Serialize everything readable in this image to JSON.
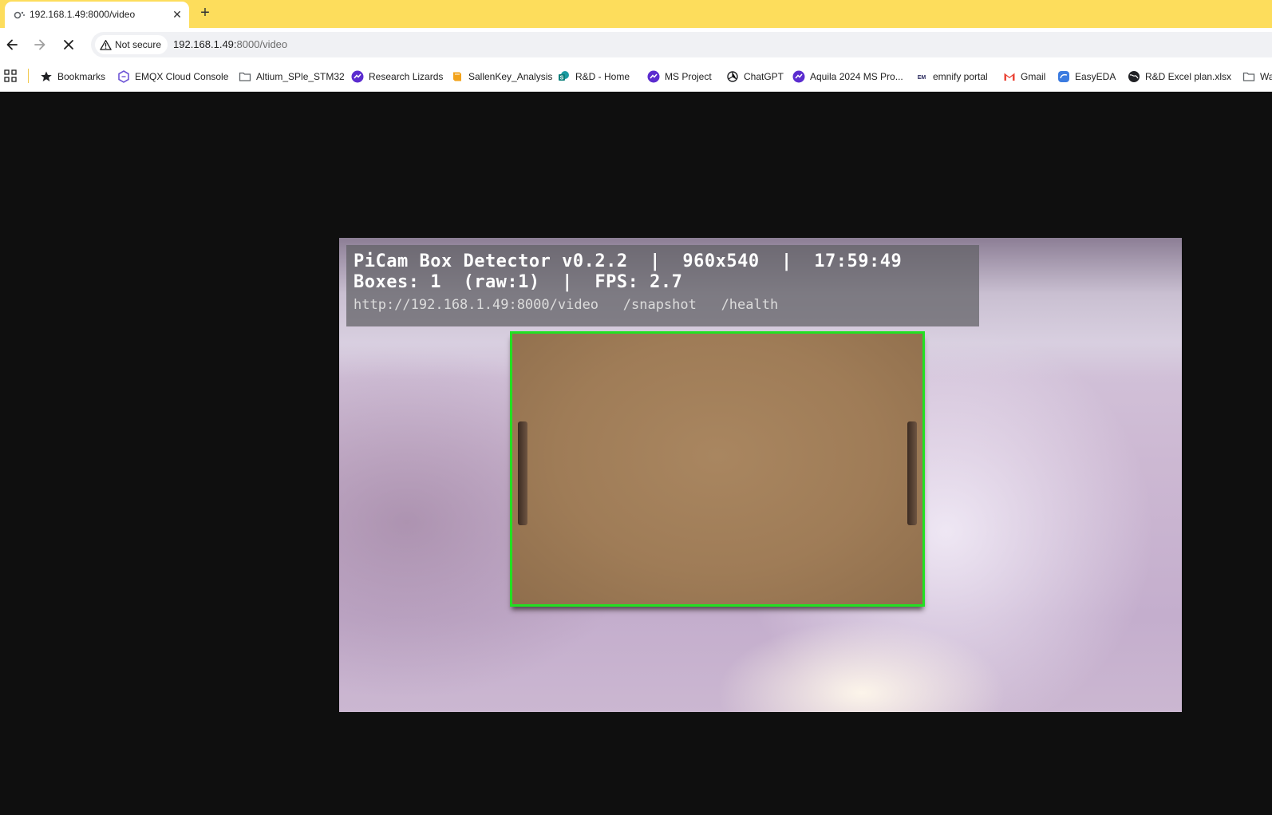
{
  "tab": {
    "title": "192.168.1.49:8000/video",
    "close_label": "✕",
    "new_tab_label": "+"
  },
  "toolbar": {
    "security_label": "Not secure",
    "url_host": "192.168.1.49:",
    "url_path": "8000/video"
  },
  "bookmarks": [
    {
      "label": "Bookmarks",
      "icon": "star-icon",
      "color": "#202124"
    },
    {
      "label": "EMQX Cloud Console",
      "icon": "emqx-icon",
      "color": "#6e55d6"
    },
    {
      "label": "Altium_SPle_STM32",
      "icon": "folder-icon",
      "color": "#5f6368"
    },
    {
      "label": "Research Lizards",
      "icon": "clickup-icon",
      "color": "#5b2ccf"
    },
    {
      "label": "SallenKey_Analysis",
      "icon": "book-icon",
      "color": "#f2a21a"
    },
    {
      "label": "R&D - Home",
      "icon": "sharepoint-icon",
      "color": "#0b7f7a"
    },
    {
      "label": "MS Project",
      "icon": "clickup-icon",
      "color": "#5b2ccf"
    },
    {
      "label": "ChatGPT",
      "icon": "openai-icon",
      "color": "#202124"
    },
    {
      "label": "Aquila 2024 MS Pro...",
      "icon": "clickup-icon",
      "color": "#5b2ccf"
    },
    {
      "label": "emnify portal",
      "icon": "emnify-icon",
      "color": "#2a2a5e"
    },
    {
      "label": "Gmail",
      "icon": "gmail-icon",
      "color": "#ea4335"
    },
    {
      "label": "EasyEDA",
      "icon": "easyeda-icon",
      "color": "#3b7be0"
    },
    {
      "label": "R&D Excel plan.xlsx",
      "icon": "globe-icon",
      "color": "#202124"
    },
    {
      "label": "Wa",
      "icon": "folder-icon",
      "color": "#5f6368"
    }
  ],
  "overlay": {
    "line1": "PiCam Box Detector v0.2.2  |  960x540  |  17:59:49",
    "line2": "Boxes: 1  (raw:1)  |  FPS: 2.7",
    "line3": "http://192.168.1.49:8000/video   /snapshot   /health"
  },
  "colors": {
    "tabstrip": "#fddd5c",
    "page_background": "#0f0f0f",
    "detection_box": "#22e022"
  }
}
